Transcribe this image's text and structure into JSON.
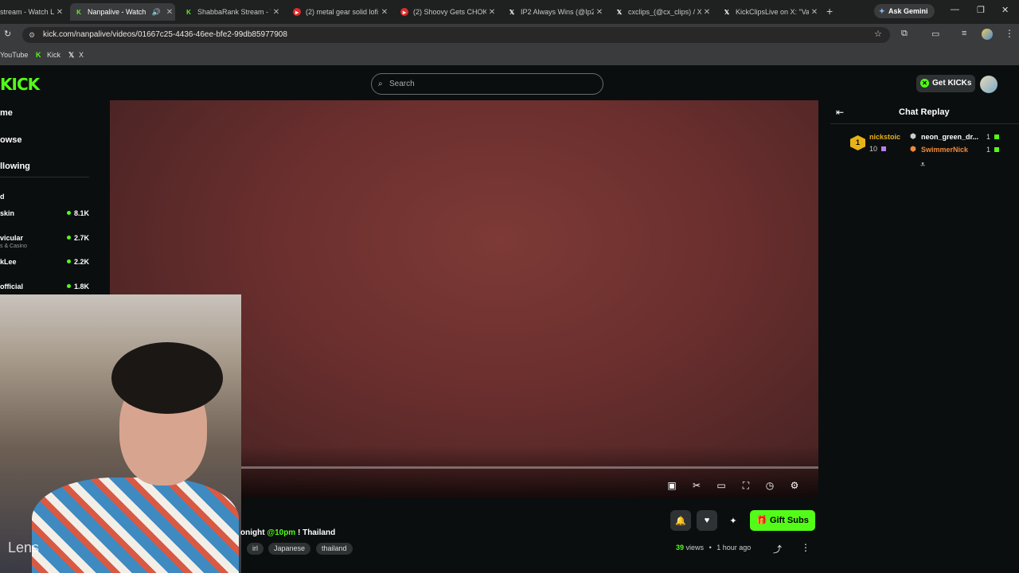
{
  "browser": {
    "tabs": [
      {
        "label": "stream - Watch L",
        "favicon": "kick-icon"
      },
      {
        "label": "Nanpalive - Watch",
        "favicon": "kick-icon",
        "active": true
      },
      {
        "label": "ShabbaRank Stream - V",
        "favicon": "kick-icon"
      },
      {
        "label": "(2) metal gear solid lofi",
        "favicon": "youtube-icon"
      },
      {
        "label": "(2) Shoovy Gets CHOK",
        "favicon": "youtube-icon"
      },
      {
        "label": "IP2 Always Wins (@Ip2",
        "favicon": "x-icon"
      },
      {
        "label": "cxclips_(@cx_clips) / X",
        "favicon": "x-icon"
      },
      {
        "label": "KickClipsLive on X: \"Va",
        "favicon": "x-icon"
      }
    ],
    "ask_gemini": "Ask Gemini",
    "url": "kick.com/nanpalive/videos/01667c25-4436-46ee-bfe2-99db85977908",
    "bookmarks": [
      "YouTube",
      "Kick",
      "X"
    ]
  },
  "header": {
    "logo": "KICK",
    "search_placeholder": "Search",
    "get_kicks": "Get KICKs"
  },
  "sidebar": {
    "nav": [
      "me",
      "owse",
      "llowing"
    ],
    "section_marker": "d",
    "channels": [
      {
        "name": "skin",
        "viewers": "8.1K",
        "sub": ""
      },
      {
        "name": "vicular",
        "viewers": "2.7K",
        "sub": "s & Casino"
      },
      {
        "name": "kLee",
        "viewers": "2.2K",
        "sub": ""
      },
      {
        "name": "official",
        "viewers": "1.8K",
        "sub": ""
      }
    ]
  },
  "video": {
    "title_prefix": "onight ",
    "title_highlight": "@10pm",
    "title_suffix": " ! Thailand",
    "tags": [
      "irl",
      "Japanese",
      "thailand"
    ],
    "views_count": "39",
    "views_label": "views",
    "time_ago": "1 hour ago",
    "gift_subs": "Gift Subs",
    "camera_watermark": "Lens"
  },
  "chat": {
    "title": "Chat Replay",
    "leaderboard": [
      {
        "name": "nickstoic",
        "count": "10",
        "rank": "1"
      },
      {
        "name": "neon_green_dr...",
        "count": "1"
      },
      {
        "name": "SwimmerNick",
        "count": "1"
      }
    ]
  },
  "colors": {
    "accent": "#53fc18",
    "bg": "#0b0e0f",
    "gold": "#e8b317",
    "orange": "#f08a3c"
  }
}
